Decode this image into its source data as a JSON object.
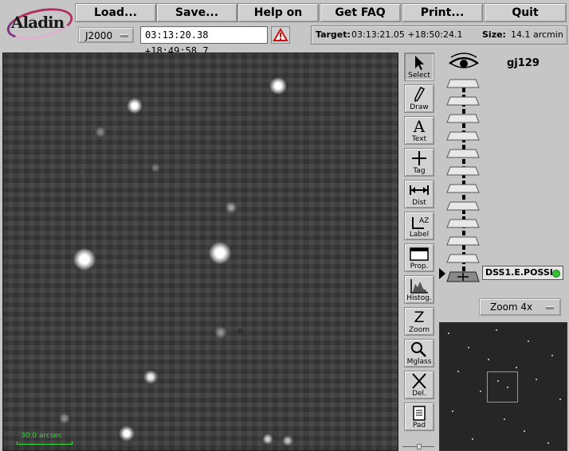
{
  "app": {
    "logo_text": "Aladin"
  },
  "menu": {
    "buttons": [
      {
        "label": "Load...",
        "name": "load-button"
      },
      {
        "label": "Save...",
        "name": "save-button"
      },
      {
        "label": "Help on",
        "name": "help-on-button"
      },
      {
        "label": "Get FAQ",
        "name": "get-faq-button"
      },
      {
        "label": "Print...",
        "name": "print-button"
      },
      {
        "label": "Quit",
        "name": "quit-button"
      }
    ]
  },
  "location": {
    "frame": "J2000",
    "coordinates": "03:13:20.38 +18:49:58.7",
    "target_label": "Target:",
    "target_value": "03:13:21.05 +18:50:24.1",
    "size_label": "Size:",
    "size_value": "14.1 arcmin"
  },
  "view": {
    "scale_label": "30.0 arcsec",
    "scale_color": "#33dd33"
  },
  "toolbar": {
    "tools": [
      {
        "name": "select",
        "label": "Select",
        "icon": "arrow-pointer-icon",
        "active": true
      },
      {
        "name": "draw",
        "label": "Draw",
        "icon": "pencil-icon"
      },
      {
        "name": "text",
        "label": "Text",
        "icon": "text-a-icon"
      },
      {
        "name": "tag",
        "label": "Tag",
        "icon": "crosshair-icon"
      },
      {
        "name": "dist",
        "label": "Dist",
        "icon": "distance-icon"
      },
      {
        "name": "label",
        "label": "Label",
        "icon": "label-az-icon"
      },
      {
        "name": "prop",
        "label": "Prop.",
        "icon": "window-icon"
      },
      {
        "name": "histog",
        "label": "Histog.",
        "icon": "histogram-icon"
      },
      {
        "name": "zoom",
        "label": "Zoom",
        "icon": "zoom-z-icon"
      },
      {
        "name": "mglass",
        "label": "Mglass",
        "icon": "magnifier-icon"
      },
      {
        "name": "del",
        "label": "Del.",
        "icon": "x-delete-icon"
      },
      {
        "name": "pad",
        "label": "Pad",
        "icon": "notepad-icon"
      }
    ]
  },
  "stack": {
    "object_name": "gj129",
    "survey": "DSS1.E.POSSI",
    "survey_status_color": "#33c033"
  },
  "zoom": {
    "level": "Zoom 4x"
  }
}
